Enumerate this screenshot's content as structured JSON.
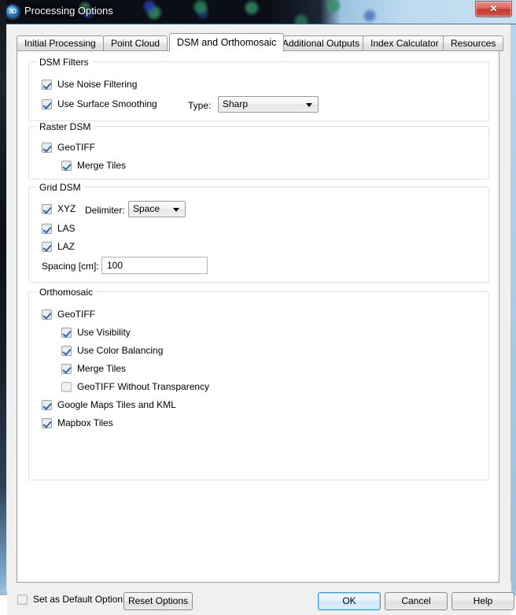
{
  "window": {
    "title": "Processing Options",
    "icon": "app-3d-icon",
    "icon_text": "3D",
    "close_label": "✕"
  },
  "tabs": [
    {
      "label": "Initial Processing",
      "active": false
    },
    {
      "label": "Point Cloud",
      "active": false
    },
    {
      "label": "DSM and Orthomosaic",
      "active": true
    },
    {
      "label": "Additional Outputs",
      "active": false
    },
    {
      "label": "Index Calculator",
      "active": false
    },
    {
      "label": "Resources",
      "active": false
    }
  ],
  "groups": {
    "dsm_filters": {
      "legend": "DSM Filters",
      "noise_filtering": {
        "label": "Use Noise Filtering",
        "checked": true
      },
      "surface_smoothing": {
        "label": "Use Surface Smoothing",
        "checked": true
      },
      "type_label": "Type:",
      "type_value": "Sharp"
    },
    "raster_dsm": {
      "legend": "Raster DSM",
      "geotiff": {
        "label": "GeoTIFF",
        "checked": true
      },
      "merge_tiles": {
        "label": "Merge Tiles",
        "checked": true
      }
    },
    "grid_dsm": {
      "legend": "Grid DSM",
      "xyz": {
        "label": "XYZ",
        "checked": true
      },
      "delimiter_label": "Delimiter:",
      "delimiter_value": "Space",
      "las": {
        "label": "LAS",
        "checked": true
      },
      "laz": {
        "label": "LAZ",
        "checked": true
      },
      "spacing_label": "Spacing [cm]:",
      "spacing_value": "100"
    },
    "orthomosaic": {
      "legend": "Orthomosaic",
      "geotiff": {
        "label": "GeoTIFF",
        "checked": true
      },
      "use_visibility": {
        "label": "Use Visibility",
        "checked": true
      },
      "use_color_balancing": {
        "label": "Use Color Balancing",
        "checked": true
      },
      "merge_tiles": {
        "label": "Merge Tiles",
        "checked": true
      },
      "geotiff_no_transparency": {
        "label": "GeoTIFF Without Transparency",
        "checked": false
      },
      "google_maps": {
        "label": "Google Maps Tiles and KML",
        "checked": true
      },
      "mapbox": {
        "label": "Mapbox Tiles",
        "checked": true
      }
    }
  },
  "footer": {
    "set_default": {
      "label": "Set as Default Options",
      "checked": false
    },
    "reset_label": "Reset Options",
    "ok_label": "OK",
    "cancel_label": "Cancel",
    "help_label": "Help"
  },
  "colors": {
    "accent_blue": "#3c9ad6",
    "check_blue": "#2e66b5",
    "panel_white": "#ffffff",
    "dialog_gray": "#f0f0f0",
    "close_red": "#c2392f"
  }
}
